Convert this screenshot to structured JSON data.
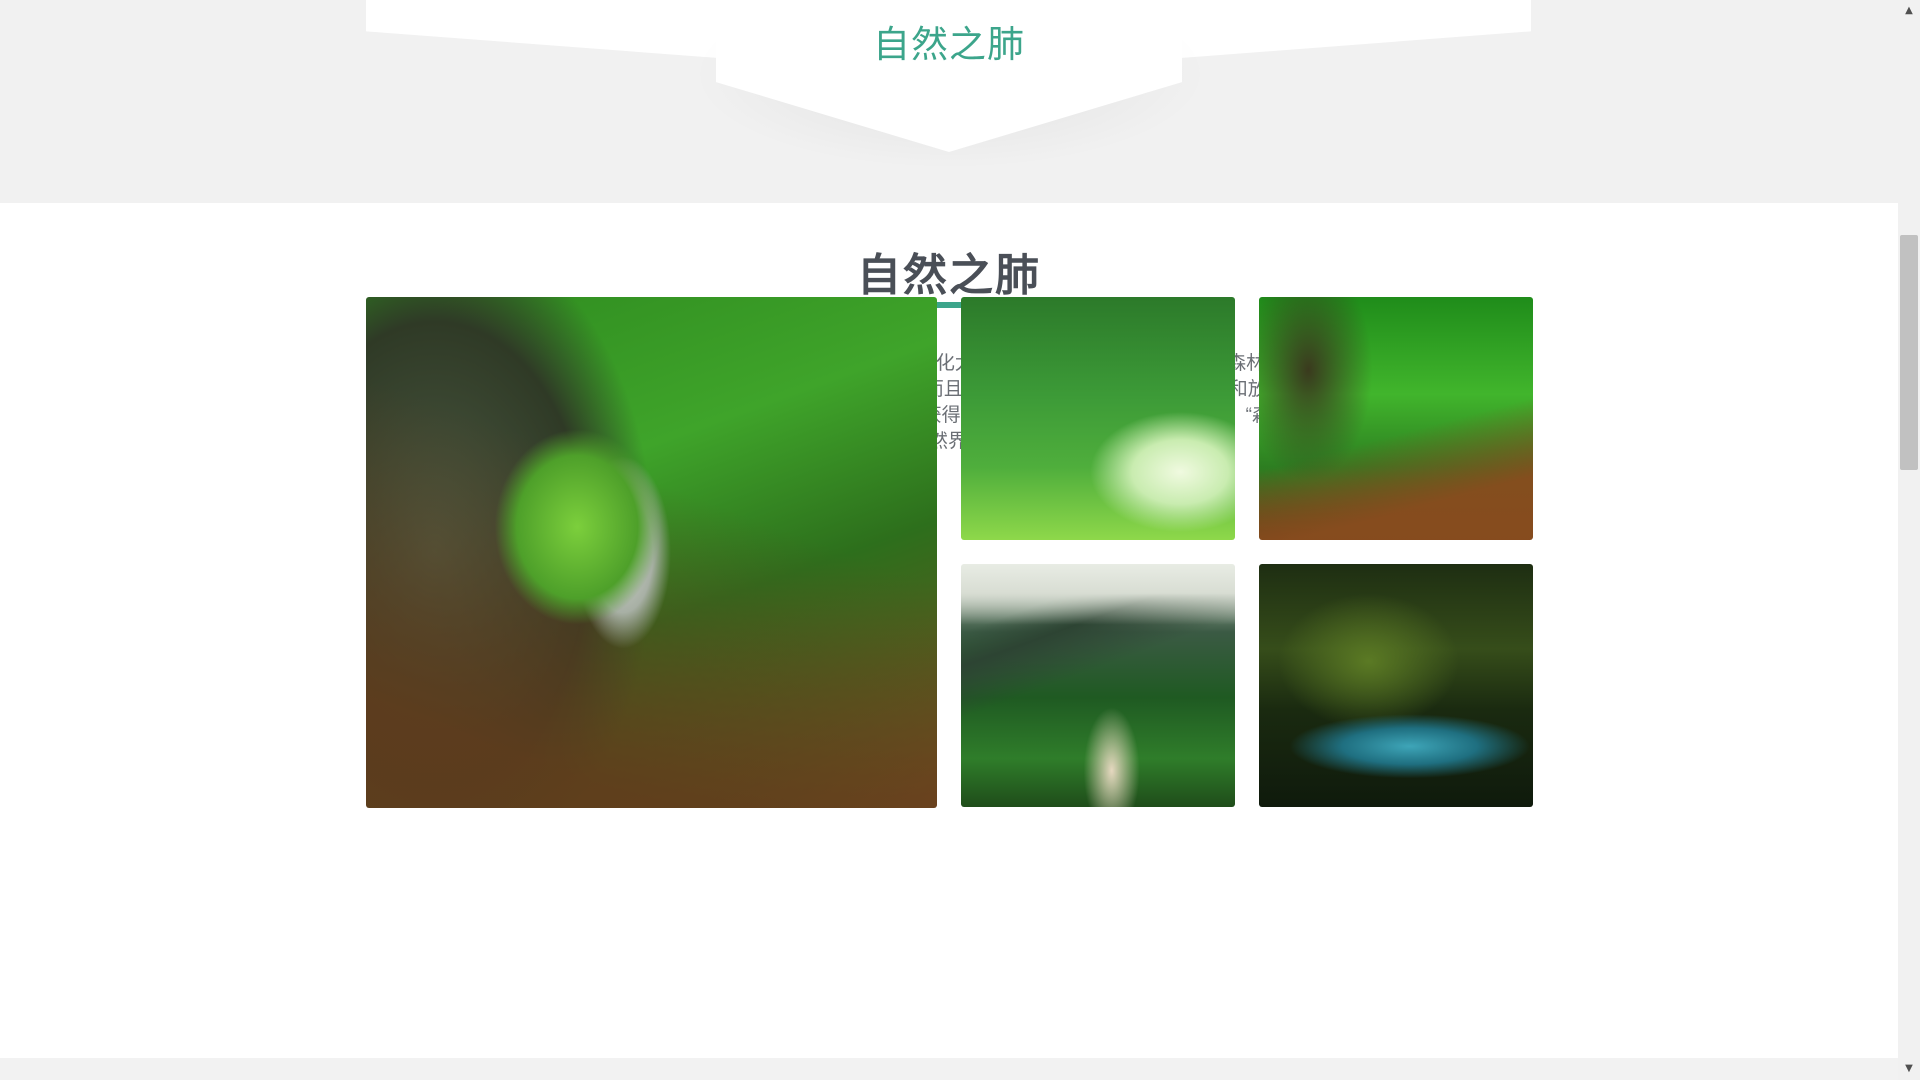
{
  "banner": {
    "title": "自然之肺"
  },
  "section": {
    "title": "自然之肺",
    "intro": "自然之肺——森林。通过绿色植物的光合作用，不但能转化太阳能而形成各种各样的有机物(森林每年提供28.3亿吨有机物，占陆地植物生产有机物总产量53亿吨的53. 4%)，而且靠光合作用吸收大量的二氧化碳和放出氧气，维系了大气中二氧化碳和氧气的平衡，净化了环境，使人类不断地获得新鲜空气。因此，生物学家曾说，“森林是地球之肺”。森林与人类的发展，与自然界的生态平衡息息相关。"
  },
  "gallery": {
    "images": [
      "forest-rock-arch-photo",
      "tree-avenue-photo",
      "forest-path-photo",
      "mountain-valley-photo",
      "forest-river-photo"
    ]
  },
  "colors": {
    "accent": "#3ca58b",
    "heading": "#4a4f57",
    "body_text": "#6b6f75",
    "page_background": "#f2f2f2"
  },
  "scrollbar": {
    "up_icon": "▲",
    "down_icon": "▼"
  }
}
